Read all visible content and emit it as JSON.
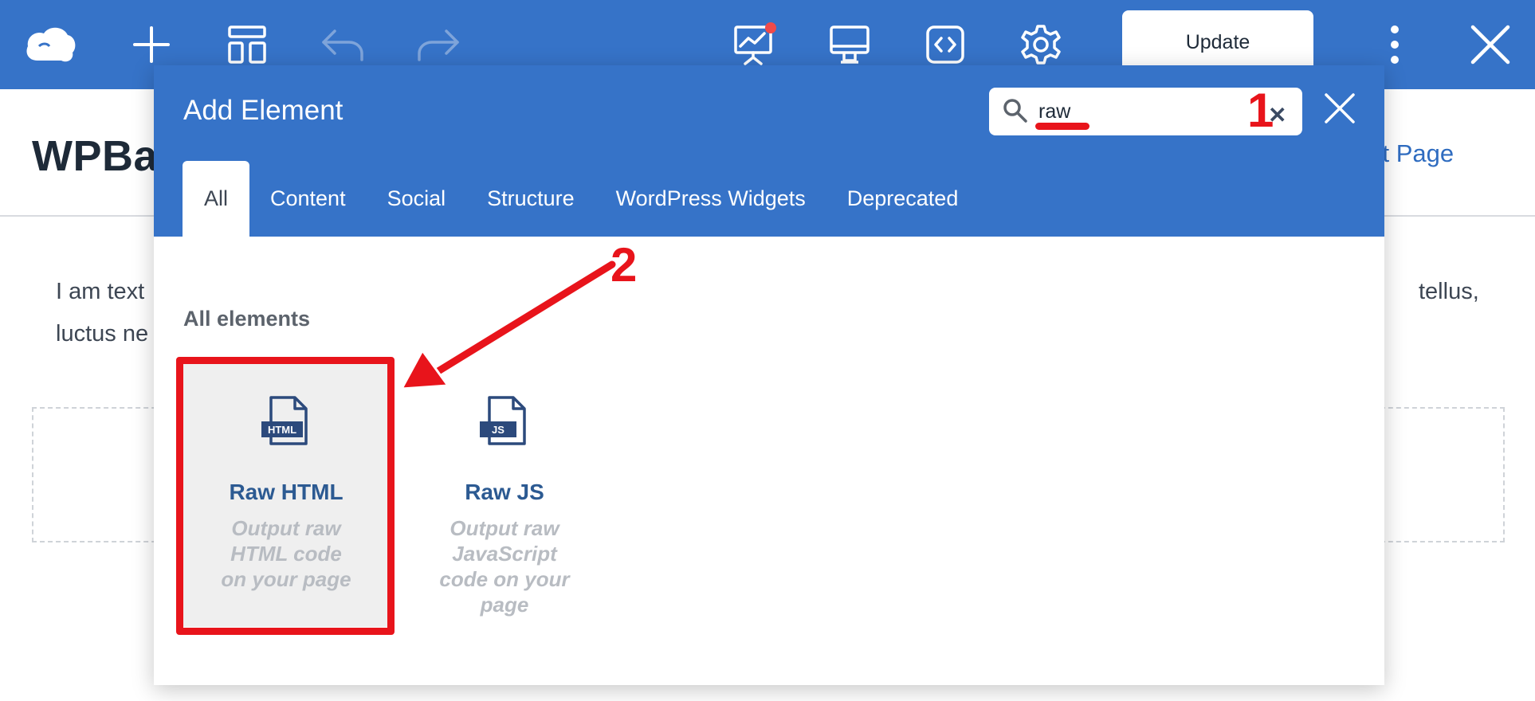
{
  "toolbar": {
    "icons": [
      "cloud-logo-icon",
      "add-icon",
      "templates-icon",
      "undo-icon",
      "redo-icon",
      "insights-icon",
      "responsive-view-icon",
      "custom-code-icon",
      "settings-icon",
      "more-icon",
      "close-icon"
    ],
    "update_label": "Update"
  },
  "page": {
    "title": "WPBal",
    "link_text": "get Page",
    "text_line1_start": "I am text",
    "text_line1_end": "tellus,",
    "text_line2_start": "luctus ne"
  },
  "modal": {
    "title": "Add Element",
    "search": {
      "value": "raw",
      "placeholder": ""
    },
    "tabs": [
      "All",
      "Content",
      "Social",
      "Structure",
      "WordPress Widgets",
      "Deprecated"
    ],
    "active_tab": "All",
    "section_label": "All elements",
    "elements": [
      {
        "name": "Raw HTML",
        "description": "Output raw HTML code on your page",
        "icon": "HTML",
        "selected": true
      },
      {
        "name": "Raw JS",
        "description": "Output raw JavaScript code on your page",
        "icon": "JS",
        "selected": false
      }
    ]
  },
  "annotations": {
    "step1": "1",
    "step2": "2"
  },
  "colors": {
    "brand_blue": "#3673c8",
    "annotation_red": "#e8141b",
    "icon_navy": "#2c4a7c"
  }
}
